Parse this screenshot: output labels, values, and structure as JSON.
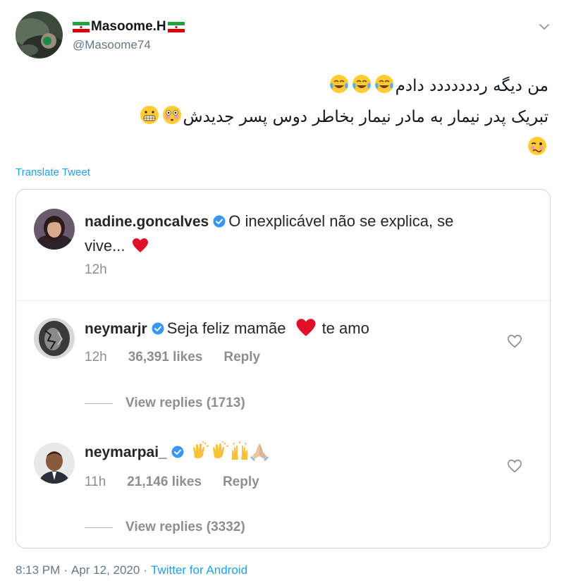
{
  "tweet": {
    "display_name": "Masoome.H",
    "handle": "@Masoome74",
    "line1": "من دیگه رددددددد دادم",
    "line2": "تبریک پدر نیمار به مادر نیمار بخاطر دوس پسر جدیدش",
    "translate_label": "Translate Tweet",
    "time": "8:13 PM",
    "separator": "·",
    "date": "Apr 12, 2020",
    "source": "Twitter for Android"
  },
  "comments": [
    {
      "username": "nadine.goncalves",
      "text_a": "O inexplicável não se explica, se",
      "text_b": "vive...",
      "age": "12h"
    },
    {
      "username": "neymarjr",
      "text_a": "Seja feliz mamãe",
      "text_b": "te amo",
      "age": "12h",
      "likes": "36,391 likes",
      "reply": "Reply",
      "view_replies": "View replies (1713)"
    },
    {
      "username": "neymarpai_",
      "age": "11h",
      "likes": "21,146 likes",
      "reply": "Reply",
      "view_replies": "View replies (3332)"
    }
  ],
  "icons": {
    "caret": "chevron-down-icon",
    "verified": "verified-badge-icon",
    "heart": "heart-icon",
    "emoji_laugh": "tears-of-joy-emoji",
    "emoji_grimace": "grimacing-emoji",
    "emoji_flushed": "flushed-emoji",
    "emoji_woozy": "woozy-emoji",
    "emoji_clap": "clapping-hands-emoji",
    "emoji_raised": "raised-hands-emoji",
    "emoji_pray": "folded-hands-emoji"
  },
  "colors": {
    "link": "#1da1f2",
    "verified": "#3897f0",
    "heart": "#e0102b",
    "muted": "#8e8e8e"
  }
}
